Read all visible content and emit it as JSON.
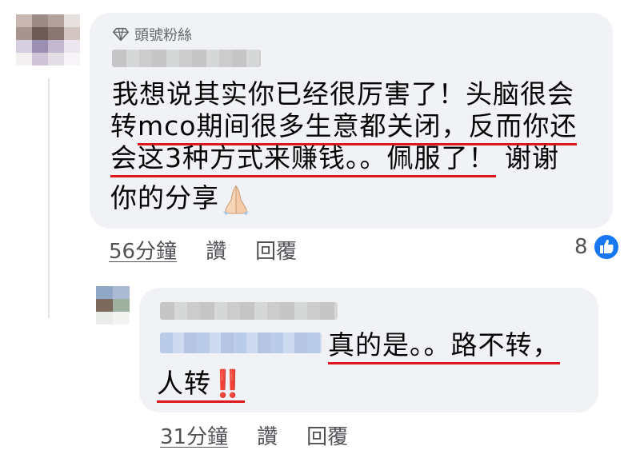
{
  "comment1": {
    "badge_label": "頭號粉絲",
    "badge_icon": "diamond-icon",
    "lines": {
      "l1": "我想说其实你已经很厉害了！头脑很会",
      "l2a": "转",
      "l2b": "mco期间很多生意都关闭，反而你还",
      "l3a": "会这3种方式来赚钱。。佩服了！",
      "l3b": " 谢谢",
      "l4": "你的分享"
    },
    "emoji": "folded-hands-emoji",
    "time": "56分鐘",
    "like_label": "讚",
    "reply_label": "回覆",
    "reaction_count": "8",
    "reaction_icon": "thumbs-up-icon",
    "reaction_color": "#1877f2"
  },
  "comment2": {
    "lines": {
      "l5": "真的是。。路不转，",
      "l6a": "人转",
      "l6b": "‼️"
    },
    "time": "31分鐘",
    "like_label": "讚",
    "reply_label": "回覆"
  },
  "colors": {
    "bubble": "#f0f2f5",
    "annotation_red": "#e0161d",
    "meta_text": "#65676b"
  }
}
